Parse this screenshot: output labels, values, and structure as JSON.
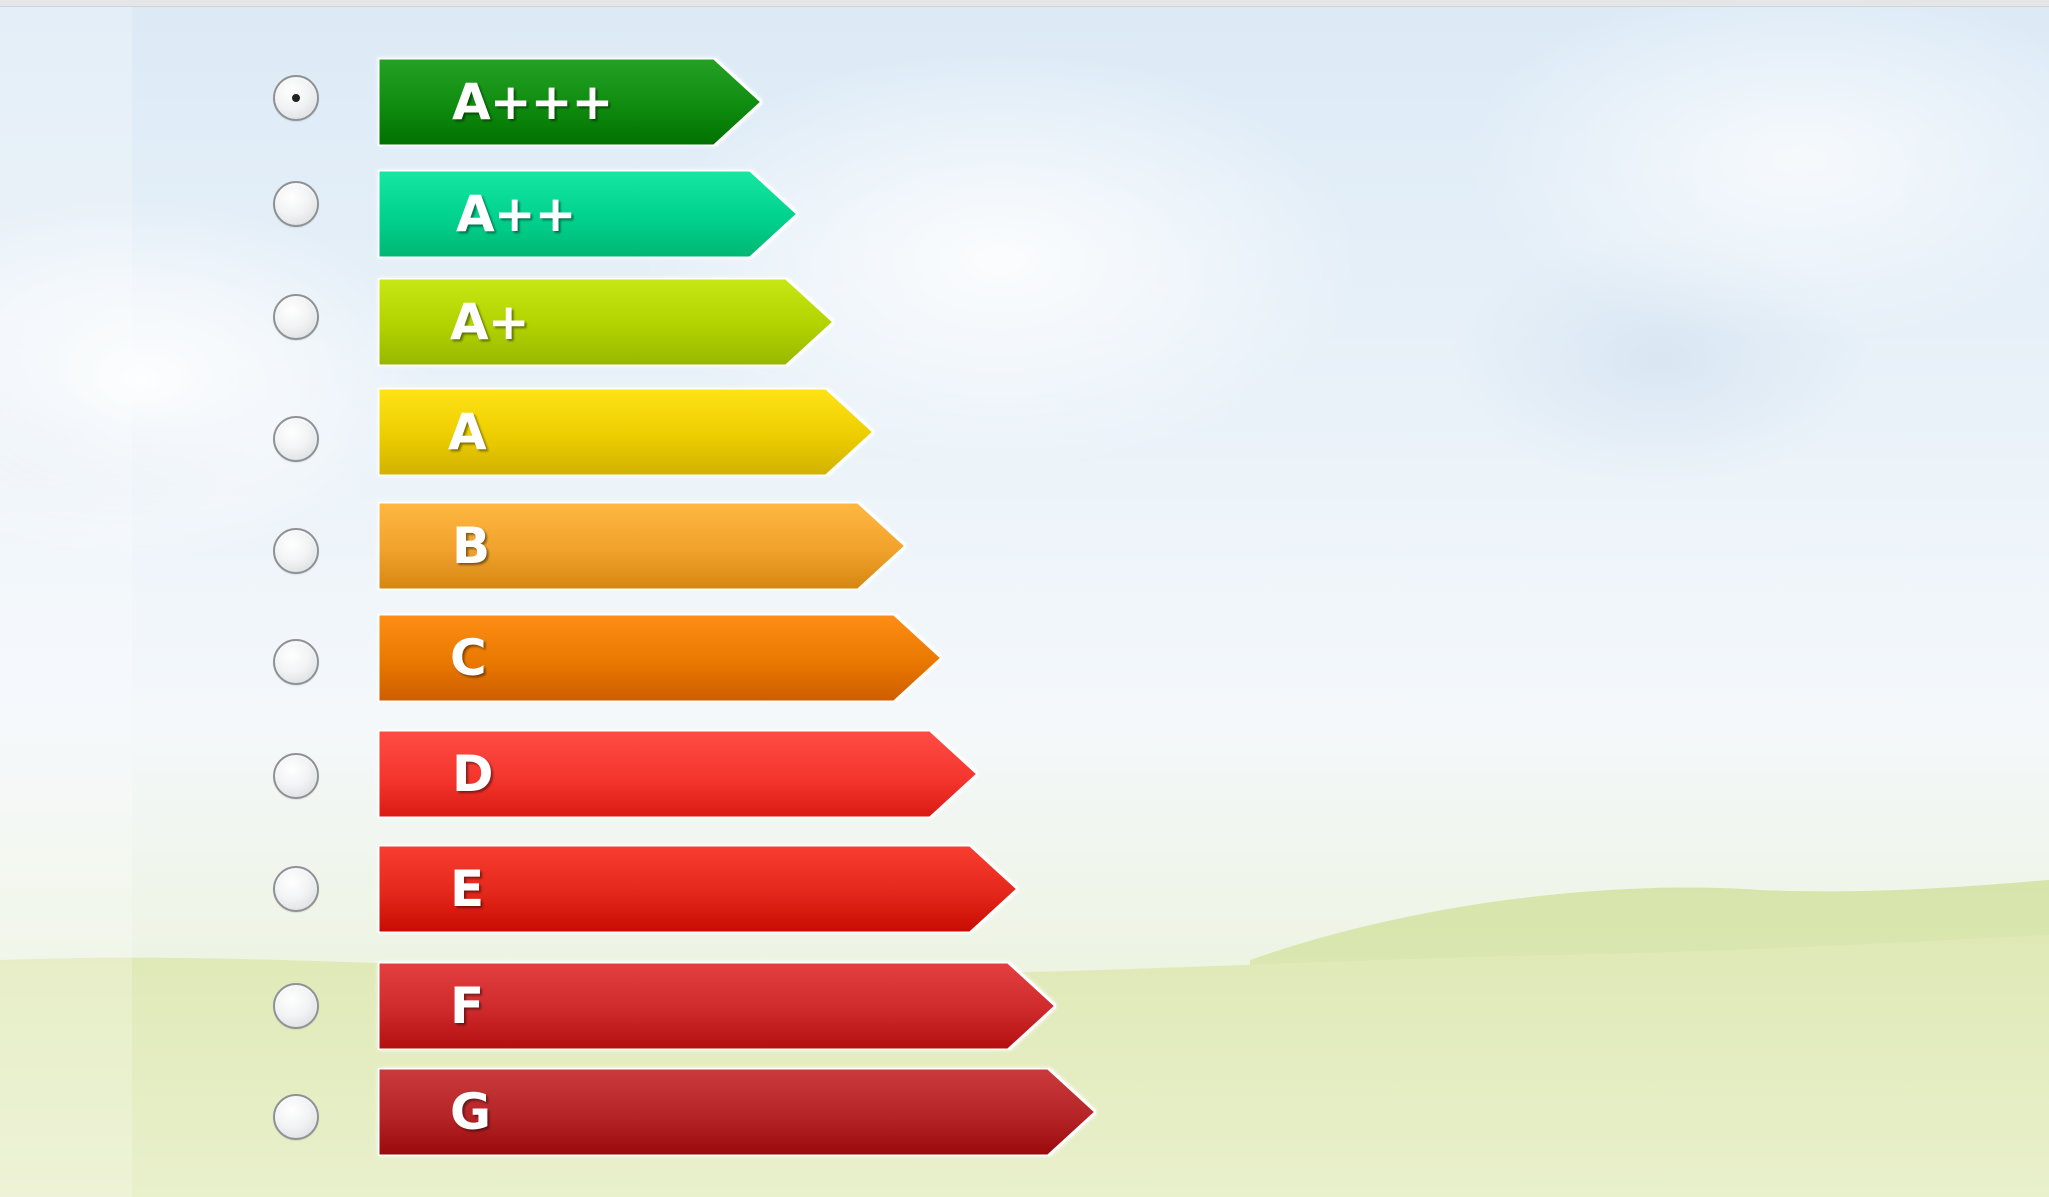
{
  "selected_class": "A+++",
  "classes": [
    {
      "label": "A+++",
      "color": "#0f8c0f",
      "selected": true
    },
    {
      "label": "A++",
      "color": "#00d28e",
      "selected": false
    },
    {
      "label": "A+",
      "color": "#b2d200",
      "selected": false
    },
    {
      "label": "A",
      "color": "#eccd00",
      "selected": false
    },
    {
      "label": "B",
      "color": "#f0a22c",
      "selected": false
    },
    {
      "label": "C",
      "color": "#e97800",
      "selected": false
    },
    {
      "label": "D",
      "color": "#f4362e",
      "selected": false
    },
    {
      "label": "E",
      "color": "#e3271b",
      "selected": false
    },
    {
      "label": "F",
      "color": "#ce2a2c",
      "selected": false
    },
    {
      "label": "G",
      "color": "#b52426",
      "selected": false
    }
  ]
}
